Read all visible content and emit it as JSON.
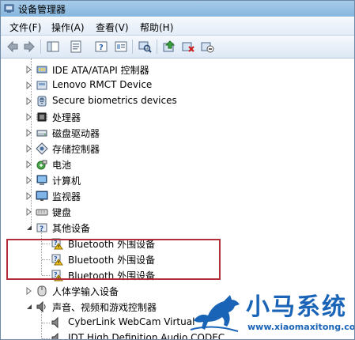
{
  "window": {
    "title": "设备管理器"
  },
  "menu": [
    "文件(F)",
    "操作(A)",
    "查看(V)",
    "帮助(H)"
  ],
  "toolbar": {
    "buttons": [
      "back-icon",
      "forward-icon",
      "show-hide-tree-icon",
      "properties-icon",
      "help-icon",
      "scan-hardware-icon",
      "update-driver-icon",
      "uninstall-icon",
      "disable-icon"
    ]
  },
  "tree": {
    "items": [
      {
        "label": "IDE ATA/ATAPI 控制器",
        "icon": "ide-controller-icon",
        "state": "collapsed"
      },
      {
        "label": "Lenovo RMCT Device",
        "icon": "device-icon",
        "state": "collapsed"
      },
      {
        "label": "Secure biometrics devices",
        "icon": "biometric-icon",
        "state": "collapsed"
      },
      {
        "label": "处理器",
        "icon": "processor-icon",
        "state": "collapsed"
      },
      {
        "label": "磁盘驱动器",
        "icon": "disk-drive-icon",
        "state": "collapsed"
      },
      {
        "label": "存储控制器",
        "icon": "storage-controller-icon",
        "state": "collapsed"
      },
      {
        "label": "电池",
        "icon": "battery-icon",
        "state": "collapsed"
      },
      {
        "label": "计算机",
        "icon": "computer-icon",
        "state": "collapsed"
      },
      {
        "label": "监视器",
        "icon": "monitor-icon",
        "state": "collapsed"
      },
      {
        "label": "键盘",
        "icon": "keyboard-icon",
        "state": "collapsed"
      },
      {
        "label": "其他设备",
        "icon": "unknown-device-icon",
        "state": "expanded"
      },
      {
        "label": "Bluetooth 外围设备",
        "icon": "warning-device-icon",
        "state": "child"
      },
      {
        "label": "Bluetooth 外围设备",
        "icon": "warning-device-icon",
        "state": "child"
      },
      {
        "label": "Bluetooth 外围设备",
        "icon": "warning-device-icon",
        "state": "child"
      },
      {
        "label": "人体学输入设备",
        "icon": "hid-icon",
        "state": "collapsed"
      },
      {
        "label": "声音、视频和游戏控制器",
        "icon": "sound-icon",
        "state": "expanded"
      },
      {
        "label": "CyberLink WebCam Virtual",
        "icon": "speaker-icon",
        "state": "child"
      },
      {
        "label": "IDT High Definition Audio CODEC",
        "icon": "speaker-icon",
        "state": "child"
      }
    ]
  },
  "watermark": {
    "title": "小马系统",
    "url": "www.xiaomaxitong.com",
    "accent": "#1a64b8"
  }
}
